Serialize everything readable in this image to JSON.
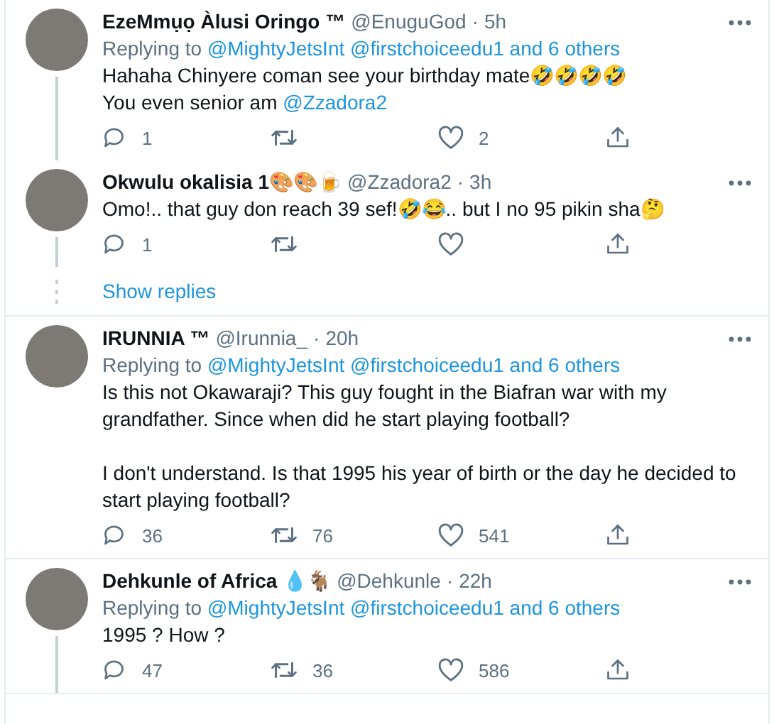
{
  "groups": [
    {
      "tweets": [
        {
          "name": "EzeMmụọ Àlusi Oringo ™",
          "handle": "@EnuguGod",
          "separator": "·",
          "time": "5h",
          "connected": true,
          "replying": {
            "prefix": "Replying to",
            "links": [
              "@MightyJetsInt",
              "@firstchoiceedu1",
              "and 6 others"
            ]
          },
          "body": [
            [
              [
                {
                  "text": "Hahaha Chinyere coman see your birthday mate🤣🤣🤣🤣",
                  "link": false
                }
              ],
              [
                {
                  "text": "You even senior am ",
                  "link": false
                },
                {
                  "text": "@Zzadora2",
                  "link": true
                }
              ]
            ]
          ],
          "actions": {
            "replies": "1",
            "likes": "2"
          }
        },
        {
          "name": "Okwulu okalisia 1🎨🎨🍺",
          "handle": "@Zzadora2",
          "separator": "·",
          "time": "3h",
          "connected": true,
          "body": [
            [
              [
                {
                  "text": "Omo!.. that guy don reach 39 sef!🤣😂.. but I no 95 pikin sha🤔",
                  "link": false
                }
              ]
            ]
          ],
          "actions": {
            "replies": "1"
          }
        }
      ],
      "show_replies": "Show replies"
    },
    {
      "tweets": [
        {
          "name": "IRUNNIA ™",
          "handle": "@Irunnia_",
          "separator": "·",
          "time": "20h",
          "connected": false,
          "replying": {
            "prefix": "Replying to",
            "links": [
              "@MightyJetsInt",
              "@firstchoiceedu1",
              "and 6 others"
            ]
          },
          "body": [
            [
              [
                {
                  "text": "Is this not Okawaraji? This guy fought in the Biafran war with my grandfather. Since when did he start playing football?",
                  "link": false
                }
              ]
            ],
            [
              [
                {
                  "text": "I don't understand. Is that 1995 his year of birth or the day he decided to start playing football?",
                  "link": false
                }
              ]
            ]
          ],
          "actions": {
            "replies": "36",
            "retweets": "76",
            "likes": "541"
          }
        }
      ]
    },
    {
      "tweets": [
        {
          "name": "Dehkunle of Africa 💧🐐",
          "handle": "@Dehkunle",
          "separator": "·",
          "time": "22h",
          "connected": true,
          "replying": {
            "prefix": "Replying to",
            "links": [
              "@MightyJetsInt",
              "@firstchoiceedu1",
              "and 6 others"
            ]
          },
          "body": [
            [
              [
                {
                  "text": "1995 ? How ?",
                  "link": false
                }
              ]
            ]
          ],
          "actions": {
            "replies": "47",
            "retweets": "36",
            "likes": "586"
          }
        }
      ]
    }
  ]
}
